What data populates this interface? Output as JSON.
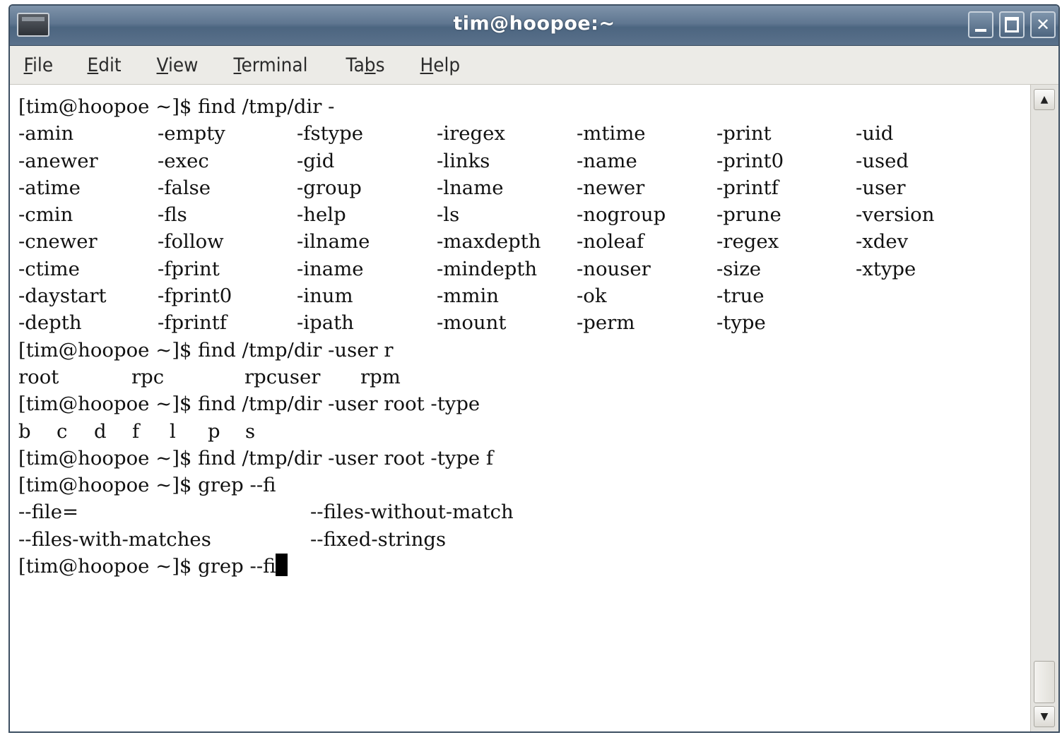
{
  "window": {
    "title": "tim@hoopoe:~"
  },
  "menu": {
    "items": [
      {
        "mnemonic": "F",
        "rest": "ile"
      },
      {
        "mnemonic": "E",
        "rest": "dit"
      },
      {
        "mnemonic": "V",
        "rest": "iew"
      },
      {
        "mnemonic": "T",
        "rest": "erminal"
      },
      {
        "mnemonic": "",
        "rest": "Ta",
        "mn2": "b",
        "rest2": "s"
      },
      {
        "mnemonic": "H",
        "rest": "elp"
      }
    ]
  },
  "terminal": {
    "prompt1": "[tim@hoopoe ~]$ find /tmp/dir -",
    "find_options": [
      [
        "-amin",
        "-empty",
        "-fstype",
        "-iregex",
        "-mtime",
        "-print",
        "-uid"
      ],
      [
        "-anewer",
        "-exec",
        "-gid",
        "-links",
        "-name",
        "-print0",
        "-used"
      ],
      [
        "-atime",
        "-false",
        "-group",
        "-lname",
        "-newer",
        "-printf",
        "-user"
      ],
      [
        "-cmin",
        "-fls",
        "-help",
        "-ls",
        "-nogroup",
        "-prune",
        "-version"
      ],
      [
        "-cnewer",
        "-follow",
        "-ilname",
        "-maxdepth",
        "-noleaf",
        "-regex",
        "-xdev"
      ],
      [
        "-ctime",
        "-fprint",
        "-iname",
        "-mindepth",
        "-nouser",
        "-size",
        "-xtype"
      ],
      [
        "-daystart",
        "-fprint0",
        "-inum",
        "-mmin",
        "-ok",
        "-true",
        ""
      ],
      [
        "-depth",
        "-fprintf",
        "-ipath",
        "-mount",
        "-perm",
        "-type",
        ""
      ]
    ],
    "prompt2": "[tim@hoopoe ~]$ find /tmp/dir -user r",
    "users": [
      "root",
      "rpc",
      "rpcuser",
      "rpm"
    ],
    "prompt3": "[tim@hoopoe ~]$ find /tmp/dir -user root -type",
    "types": [
      "b",
      "c",
      "d",
      "f",
      "l",
      "p",
      "s"
    ],
    "prompt4": "[tim@hoopoe ~]$ find /tmp/dir -user root -type f",
    "prompt5": "[tim@hoopoe ~]$ grep --fi",
    "grep_options": [
      [
        "--file=",
        "--files-without-match"
      ],
      [
        "--files-with-matches",
        "--fixed-strings"
      ]
    ],
    "prompt6": "[tim@hoopoe ~]$ grep --fi"
  },
  "icons": {
    "app": "terminal-icon",
    "minimize": "minimize-icon",
    "maximize": "maximize-icon",
    "close": "close-icon",
    "scroll_up": "arrow-up-icon",
    "scroll_down": "arrow-down-icon"
  },
  "colors": {
    "titlebar": "#5f7690",
    "menubar": "#ecebe7",
    "terminal_bg": "#ffffff",
    "terminal_fg": "#111111"
  }
}
